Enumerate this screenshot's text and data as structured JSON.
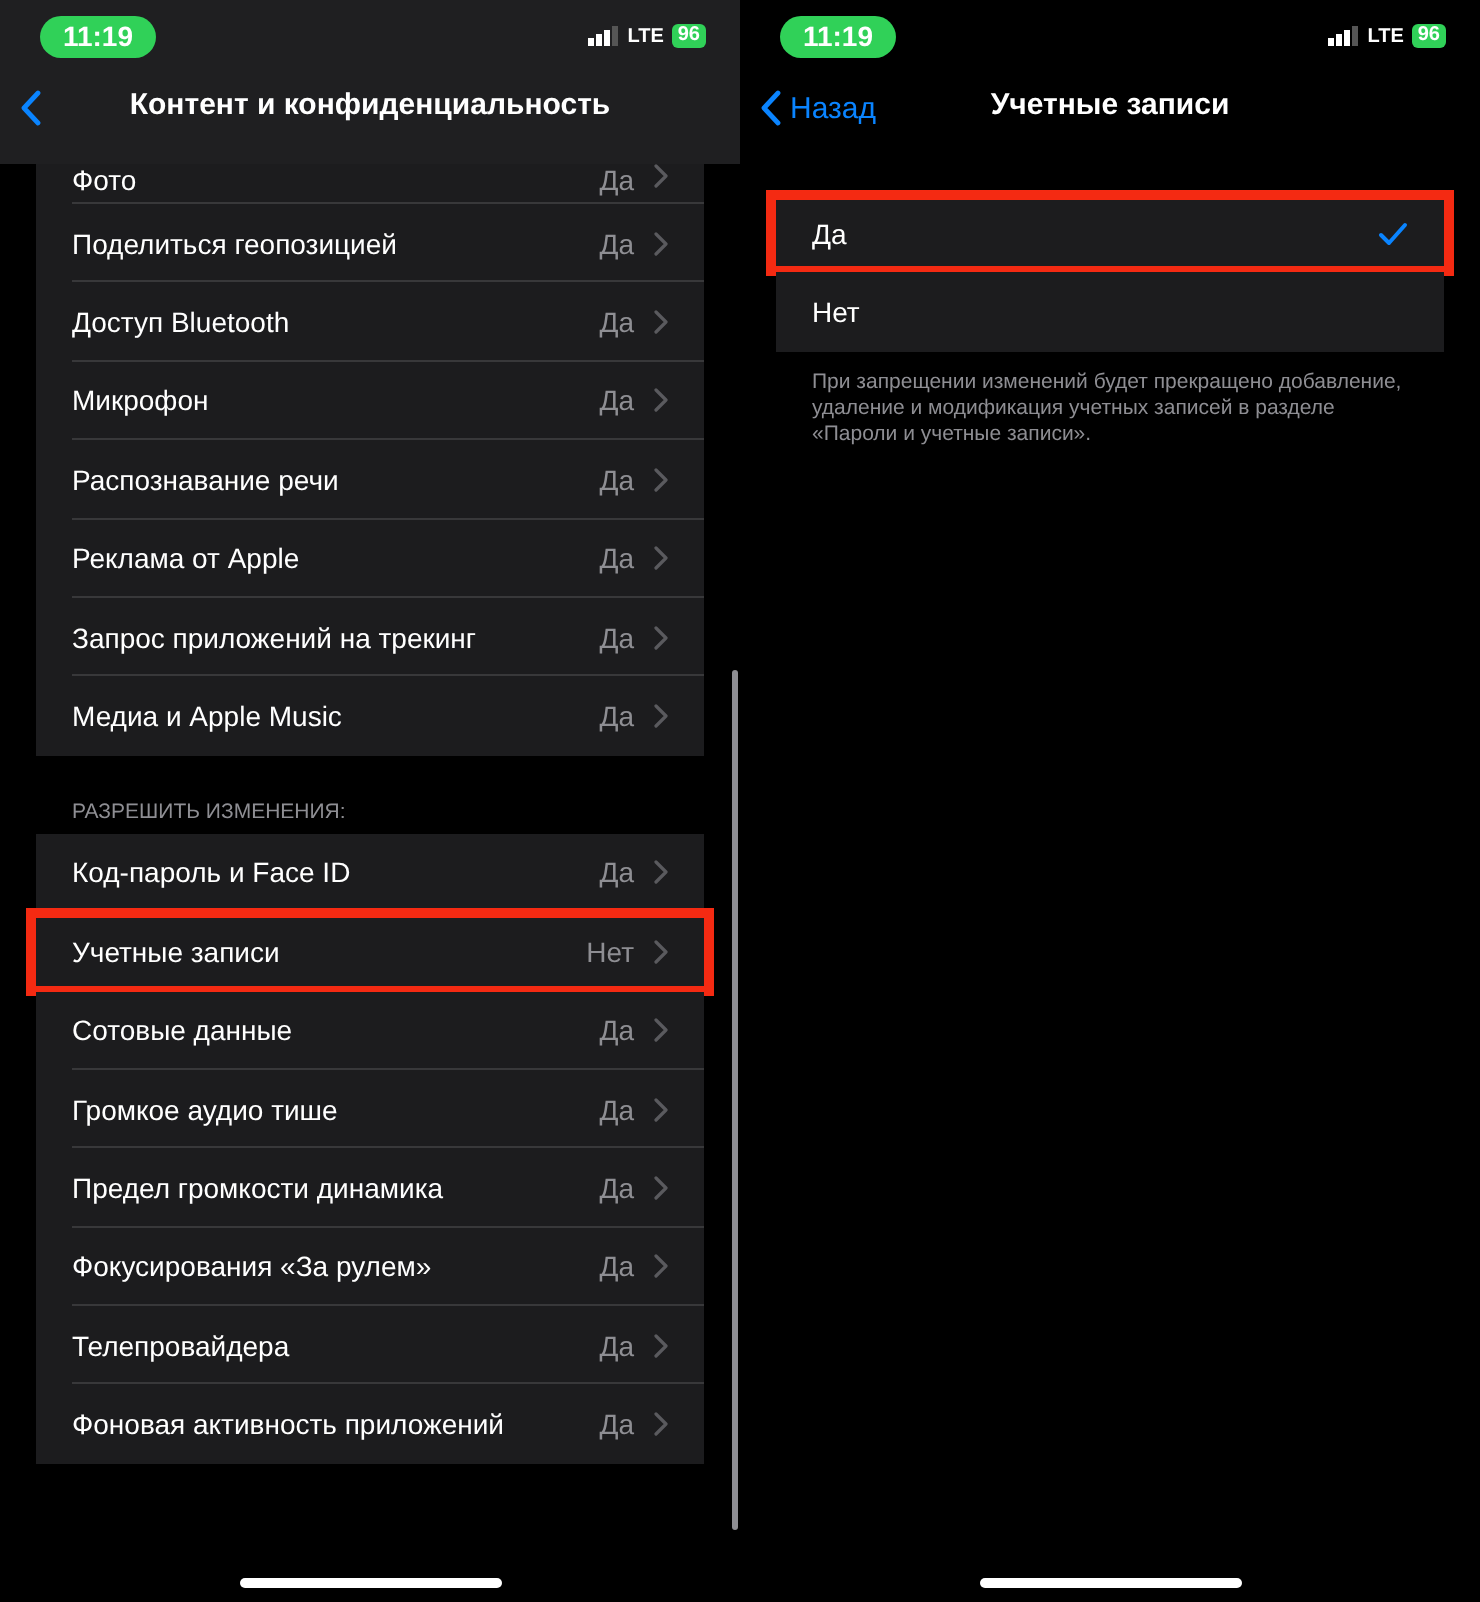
{
  "screens": [
    {
      "status_bar": {
        "time": "11:19",
        "network": "LTE",
        "battery": "96"
      },
      "nav": {
        "title": "Контент и конфиденциальность",
        "kind": "overlay"
      },
      "sections": [
        {
          "items": [
            {
              "kind": "link",
              "label": "Фото",
              "value": "Да",
              "highlighted": false
            },
            {
              "kind": "link",
              "label": "Поделиться геопозицией",
              "value": "Да",
              "highlighted": false
            },
            {
              "kind": "link",
              "label": "Доступ Bluetooth",
              "value": "Да",
              "highlighted": false
            },
            {
              "kind": "link",
              "label": "Микрофон",
              "value": "Да",
              "highlighted": false
            },
            {
              "kind": "link",
              "label": "Распознавание речи",
              "value": "Да",
              "highlighted": false
            },
            {
              "kind": "link",
              "label": "Реклама от Apple",
              "value": "Да",
              "highlighted": false
            },
            {
              "kind": "link",
              "label": "Запрос приложений на трекинг",
              "value": "Да",
              "highlighted": false
            },
            {
              "kind": "link",
              "label": "Медиа и Apple Music",
              "value": "Да",
              "highlighted": false
            }
          ]
        },
        {
          "header": "РАЗРЕШИТЬ ИЗМЕНЕНИЯ:",
          "items": [
            {
              "kind": "link",
              "label": "Код-пароль и Face ID",
              "value": "Да",
              "highlighted": false
            },
            {
              "kind": "link",
              "label": "Учетные записи",
              "value": "Нет",
              "highlighted": true
            },
            {
              "kind": "link",
              "label": "Сотовые данные",
              "value": "Да",
              "highlighted": false
            },
            {
              "kind": "link",
              "label": "Громкое аудио тише",
              "value": "Да",
              "highlighted": false
            },
            {
              "kind": "link",
              "label": "Предел громкости динамика",
              "value": "Да",
              "highlighted": false
            },
            {
              "kind": "link",
              "label": "Фокусирования «За рулем»",
              "value": "Да",
              "highlighted": false
            },
            {
              "kind": "link",
              "label": "Телепровайдера",
              "value": "Да",
              "highlighted": false
            },
            {
              "kind": "link",
              "label": "Фоновая активность приложений",
              "value": "Да",
              "highlighted": false
            }
          ]
        }
      ]
    },
    {
      "status_bar": {
        "time": "11:19",
        "network": "LTE",
        "battery": "96"
      },
      "nav": {
        "back": "Назад",
        "title": "Учетные записи",
        "kind": "plain"
      },
      "sections": [
        {
          "items": [
            {
              "kind": "choice",
              "label": "Да",
              "selected": true,
              "highlighted": true
            },
            {
              "kind": "choice",
              "label": "Нет",
              "selected": false,
              "highlighted": false
            }
          ],
          "footer": "При запрещении изменений будет прекращено добавление, удаление и модификация учетных записей в разделе «Пароли и учетные записи»."
        }
      ]
    }
  ]
}
